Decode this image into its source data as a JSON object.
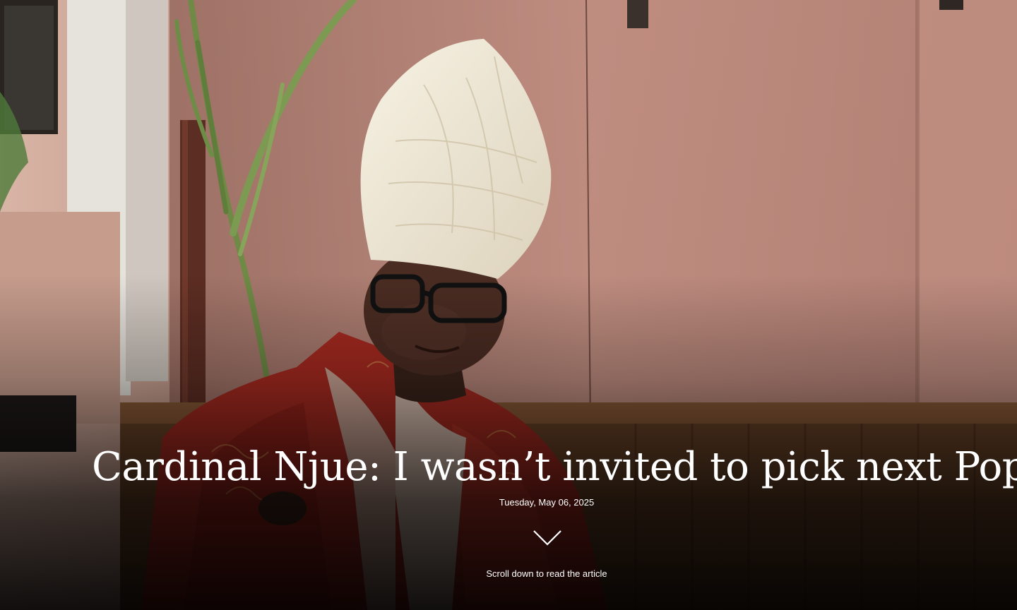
{
  "article": {
    "headline": "Cardinal Njue: I wasn’t invited to pick next Pope",
    "date": "Tuesday, May 06, 2025"
  },
  "hero_image": {
    "alt": "Cardinal Njue in a white mitre and red vestments holding a palm frond"
  },
  "scroll": {
    "icon": "chevron-down-icon",
    "label": "Scroll down to read the article"
  },
  "colors": {
    "text": "#ffffff",
    "wall": "#b8867a",
    "vestment": "#b3241c",
    "mitre": "#efe8d6"
  }
}
